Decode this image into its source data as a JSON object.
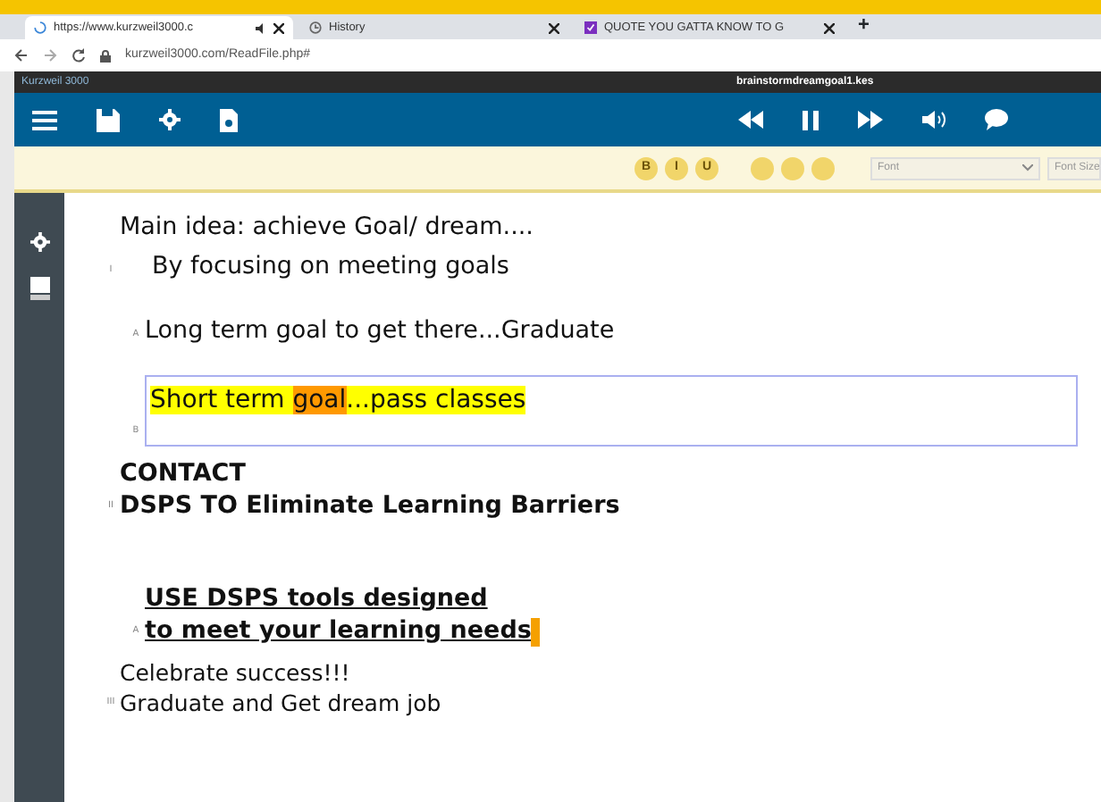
{
  "browser": {
    "tabs": [
      {
        "label": "https://www.kurzweil3000.c",
        "selected": true,
        "kind": "page"
      },
      {
        "label": "History",
        "selected": false,
        "kind": "history"
      },
      {
        "label": "QUOTE YOU GATTA KNOW TO G",
        "selected": false,
        "kind": "site"
      }
    ],
    "new_tab": "+",
    "address": "kurzweil3000.com/ReadFile.php#"
  },
  "app": {
    "title": "Kurzweil 3000",
    "file_name": "brainstormdreamgoal1.kes"
  },
  "format_bar": {
    "style_buttons": [
      "B",
      "I",
      "U"
    ],
    "font": "Font",
    "font_size": "Font Size"
  },
  "document": {
    "items": [
      {
        "marker": "I",
        "kind": "plain",
        "lines": [
          "Main idea: achieve Goal/ dream....",
          "By focusing on meeting goals"
        ],
        "children": [
          {
            "marker": "A",
            "kind": "plain",
            "lines": [
              "Long term goal to get there...Graduate"
            ]
          },
          {
            "marker": "B",
            "kind": "box",
            "segments": [
              {
                "text": "Short term ",
                "color": "#ffff00"
              },
              {
                "text": "goal",
                "color": "#ff9900"
              },
              {
                "text": "...pass classes",
                "color": "#ffff00"
              }
            ]
          }
        ]
      },
      {
        "marker": "II",
        "kind": "bold",
        "lines": [
          "CONTACT",
          "DSPS TO Eliminate Learning Barriers"
        ],
        "children": [
          {
            "marker": "A",
            "kind": "underline",
            "lines": [
              "USE DSPS tools designed",
              "to meet your learning needs"
            ]
          }
        ]
      },
      {
        "marker": "III",
        "kind": "semibold",
        "lines": [
          "Celebrate success!!!",
          "Graduate and Get dream job"
        ]
      }
    ]
  }
}
